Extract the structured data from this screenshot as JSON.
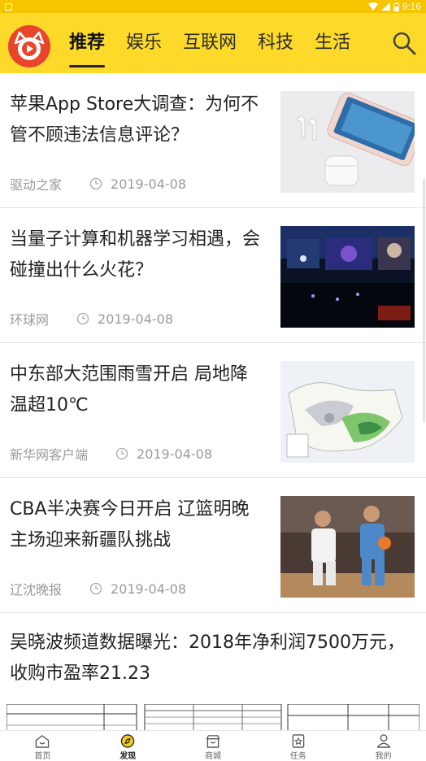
{
  "status_bar": {
    "time": "9:16"
  },
  "header": {
    "tabs": [
      {
        "label": "推荐",
        "active": true
      },
      {
        "label": "娱乐",
        "active": false
      },
      {
        "label": "互联网",
        "active": false
      },
      {
        "label": "科技",
        "active": false
      },
      {
        "label": "生活",
        "active": false
      }
    ]
  },
  "news": [
    {
      "title": "苹果App Store大调查：为何不管不顾违法信息评论？",
      "source": "驱动之家",
      "date": "2019-04-08",
      "thumb": "iphone-airpods-photo"
    },
    {
      "title": "当量子计算和机器学习相遇，会碰撞出什么火花？",
      "source": "环球网",
      "date": "2019-04-08",
      "thumb": "conference-stage-photo"
    },
    {
      "title": "中东部大范围雨雪开启 局地降温超10℃",
      "source": "新华网客户端",
      "date": "2019-04-08",
      "thumb": "weather-map"
    },
    {
      "title": "CBA半决赛今日开启 辽篮明晚主场迎来新疆队挑战",
      "source": "辽沈晚报",
      "date": "2019-04-08",
      "thumb": "basketball-photo"
    }
  ],
  "wide_news": {
    "title": "吴晓波频道数据曝光：2018年净利润7500万元，收购市盈率21.23"
  },
  "bottom_nav": [
    {
      "label": "首页",
      "icon": "home-icon",
      "active": false
    },
    {
      "label": "发现",
      "icon": "discover-icon",
      "active": true
    },
    {
      "label": "商城",
      "icon": "shop-icon",
      "active": false
    },
    {
      "label": "任务",
      "icon": "task-icon",
      "active": false
    },
    {
      "label": "我的",
      "icon": "profile-icon",
      "active": false
    }
  ],
  "colors": {
    "header_bg": "#fdd92a",
    "status_bg": "#f7c500",
    "logo_red": "#e8452c",
    "meta_gray": "#9a9a9a"
  }
}
